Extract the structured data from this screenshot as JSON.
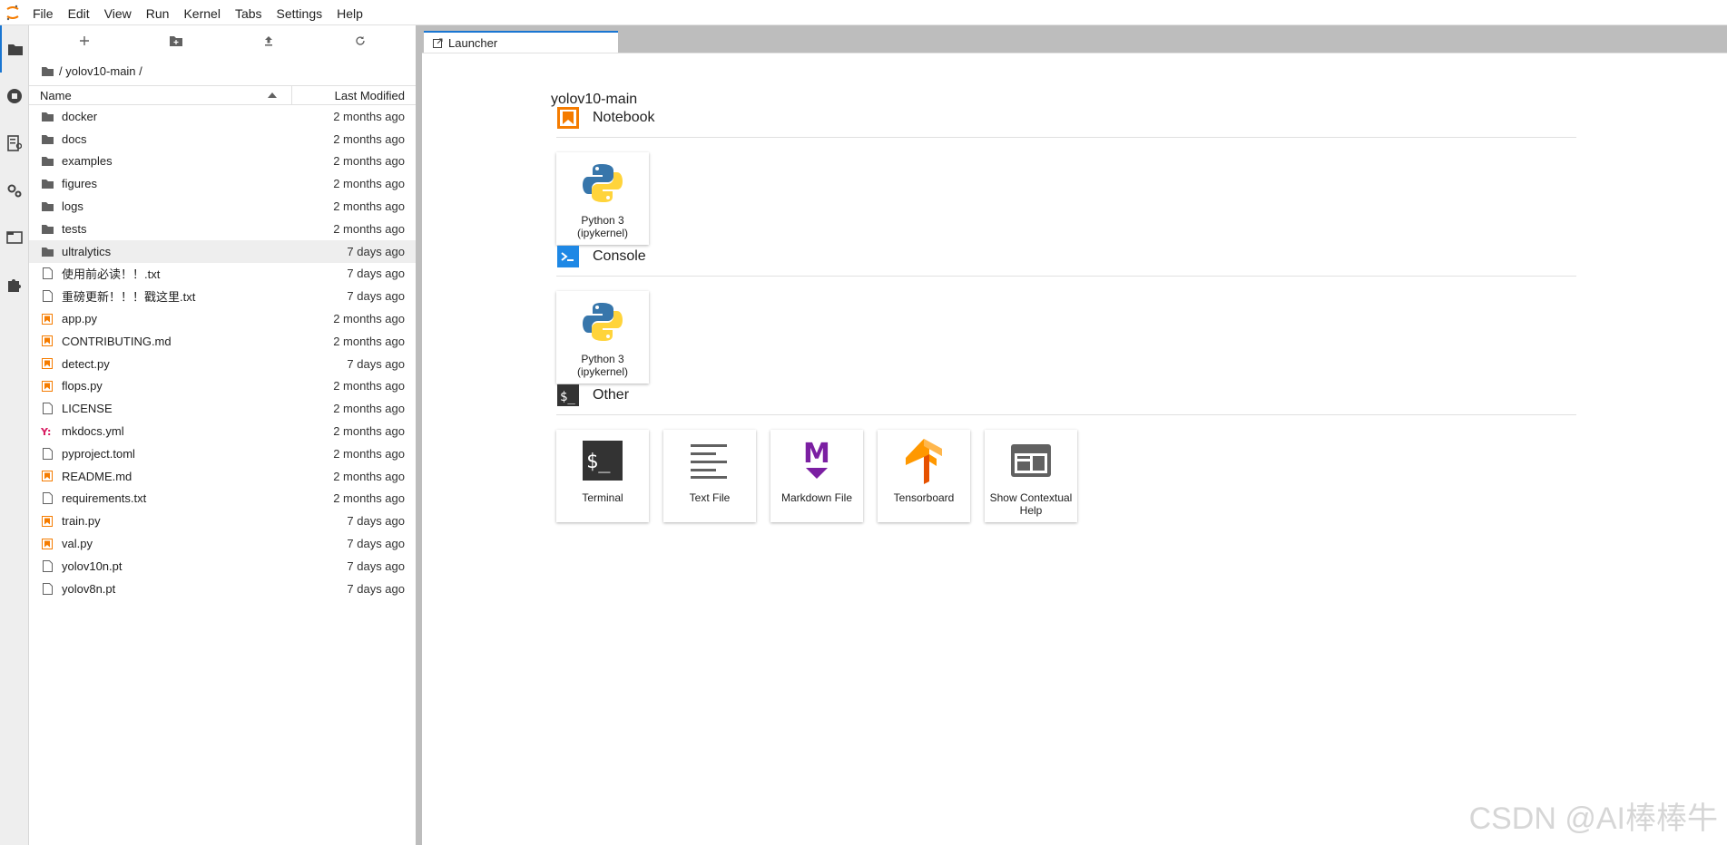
{
  "menubar": {
    "items": [
      "File",
      "Edit",
      "View",
      "Run",
      "Kernel",
      "Tabs",
      "Settings",
      "Help"
    ]
  },
  "filebrowser": {
    "breadcrumb": "/ yolov10-main /",
    "columns": {
      "name": "Name",
      "modified": "Last Modified"
    },
    "rows": [
      {
        "name": "docker",
        "modified": "2 months ago",
        "icon": "folder-icon"
      },
      {
        "name": "docs",
        "modified": "2 months ago",
        "icon": "folder-icon"
      },
      {
        "name": "examples",
        "modified": "2 months ago",
        "icon": "folder-icon"
      },
      {
        "name": "figures",
        "modified": "2 months ago",
        "icon": "folder-icon"
      },
      {
        "name": "logs",
        "modified": "2 months ago",
        "icon": "folder-icon"
      },
      {
        "name": "tests",
        "modified": "2 months ago",
        "icon": "folder-icon"
      },
      {
        "name": "ultralytics",
        "modified": "7 days ago",
        "icon": "folder-icon"
      },
      {
        "name": "使用前必读！！.txt",
        "modified": "7 days ago",
        "icon": "file-icon"
      },
      {
        "name": "重磅更新！！！戳这里.txt",
        "modified": "7 days ago",
        "icon": "file-icon"
      },
      {
        "name": "app.py",
        "modified": "2 months ago",
        "icon": "python-file-icon"
      },
      {
        "name": "CONTRIBUTING.md",
        "modified": "2 months ago",
        "icon": "markdown-file-icon"
      },
      {
        "name": "detect.py",
        "modified": "7 days ago",
        "icon": "python-file-icon"
      },
      {
        "name": "flops.py",
        "modified": "2 months ago",
        "icon": "python-file-icon"
      },
      {
        "name": "LICENSE",
        "modified": "2 months ago",
        "icon": "file-icon"
      },
      {
        "name": "mkdocs.yml",
        "modified": "2 months ago",
        "icon": "yaml-file-icon"
      },
      {
        "name": "pyproject.toml",
        "modified": "2 months ago",
        "icon": "file-icon"
      },
      {
        "name": "README.md",
        "modified": "2 months ago",
        "icon": "markdown-file-icon"
      },
      {
        "name": "requirements.txt",
        "modified": "2 months ago",
        "icon": "file-icon"
      },
      {
        "name": "train.py",
        "modified": "7 days ago",
        "icon": "python-file-icon"
      },
      {
        "name": "val.py",
        "modified": "7 days ago",
        "icon": "python-file-icon"
      },
      {
        "name": "yolov10n.pt",
        "modified": "7 days ago",
        "icon": "file-icon"
      },
      {
        "name": "yolov8n.pt",
        "modified": "7 days ago",
        "icon": "file-icon"
      }
    ]
  },
  "tabs": {
    "launcher": "Launcher"
  },
  "launcher": {
    "title": "yolov10-main",
    "notebook": {
      "label": "Notebook",
      "cards": [
        {
          "label": "Python 3 (ipykernel)"
        }
      ]
    },
    "console": {
      "label": "Console",
      "cards": [
        {
          "label": "Python 3 (ipykernel)"
        }
      ]
    },
    "other": {
      "label": "Other",
      "cards": [
        {
          "label": "Terminal"
        },
        {
          "label": "Text File"
        },
        {
          "label": "Markdown File"
        },
        {
          "label": "Tensorboard"
        },
        {
          "label": "Show Contextual Help"
        }
      ]
    }
  },
  "watermark": "CSDN @AI棒棒牛",
  "colors": {
    "accent": "#1976d2",
    "orange": "#f57c00",
    "console": "#1e88e5"
  }
}
